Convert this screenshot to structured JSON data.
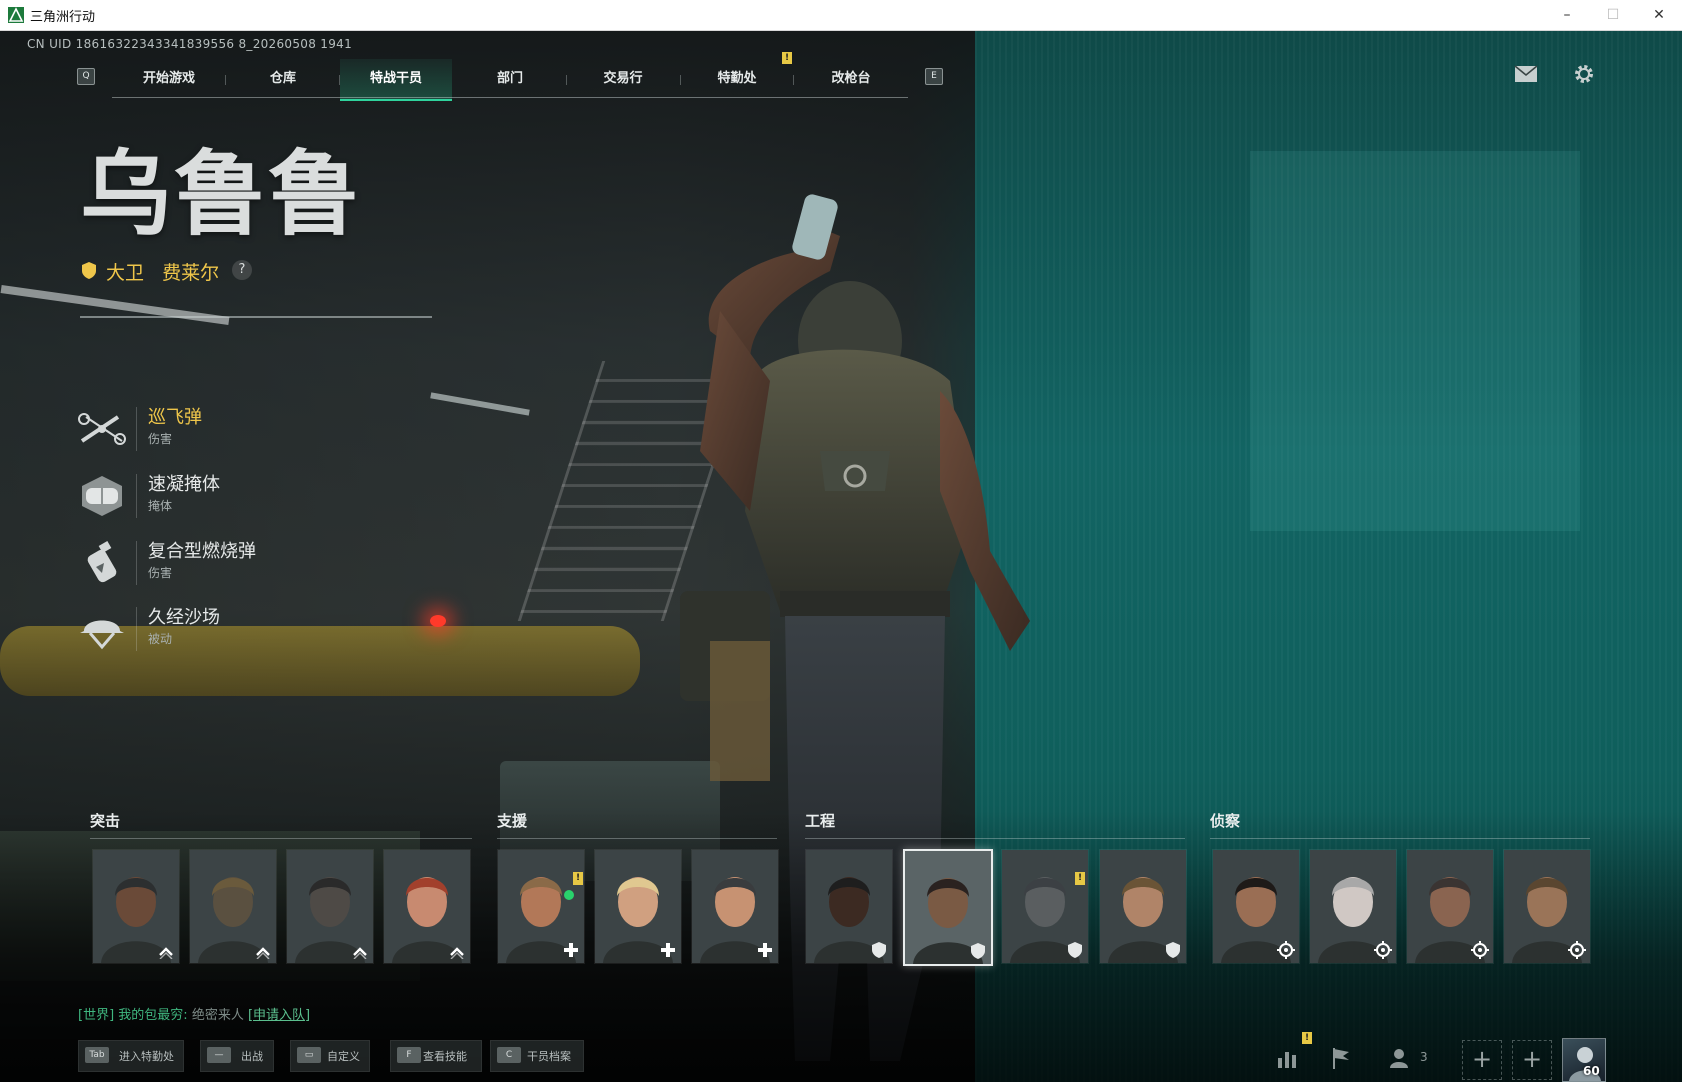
{
  "window": {
    "title": "三角洲行动",
    "controls": {
      "minimize": "–",
      "maximize": "☐",
      "close": "✕"
    }
  },
  "hud": {
    "uid": "CN UID 18616322343341839556 8_20260508 1941",
    "nav_key_left": "Q",
    "nav_key_right": "E",
    "nav_badge": "!",
    "tabs": [
      {
        "label": "开始游戏",
        "active": false
      },
      {
        "label": "仓库",
        "active": false
      },
      {
        "label": "特战干员",
        "active": true
      },
      {
        "label": "部门",
        "active": false
      },
      {
        "label": "交易行",
        "active": false
      },
      {
        "label": "特勤处",
        "active": false
      },
      {
        "label": "改枪台",
        "active": false
      }
    ],
    "mail_icon": "mail-icon",
    "settings_icon": "gear-icon"
  },
  "operator": {
    "codename": "乌鲁鲁",
    "realname": "大卫   费莱尔",
    "help": "?",
    "accent": "#efc64a",
    "skills": [
      {
        "name": "巡飞弹",
        "type": "伤害",
        "icon": "drone-icon",
        "active": true
      },
      {
        "name": "速凝掩体",
        "type": "掩体",
        "icon": "cover-icon",
        "active": false
      },
      {
        "name": "复合型燃烧弹",
        "type": "伤害",
        "icon": "grenade-icon",
        "active": false
      },
      {
        "name": "久经沙场",
        "type": "被动",
        "icon": "helmet-icon",
        "active": false
      }
    ]
  },
  "roster": {
    "categories": [
      {
        "label": "突击",
        "badge_icon": "chevron-up-icon"
      },
      {
        "label": "支援",
        "badge_icon": "plus-icon"
      },
      {
        "label": "工程",
        "badge_icon": "shield-icon"
      },
      {
        "label": "侦察",
        "badge_icon": "target-icon"
      }
    ],
    "warn_badge": "!"
  },
  "chat": {
    "channel": "[世界]",
    "name": "我的包最穷:",
    "message": " 绝密来人 ",
    "link": "[申请入队]"
  },
  "hotkeys": [
    {
      "key": "Tab",
      "label": "进入特勤处"
    },
    {
      "key": "—",
      "label": "出战"
    },
    {
      "key": "▭",
      "label": "自定义"
    },
    {
      "key": "F",
      "label": "查看技能"
    },
    {
      "key": "C",
      "label": "干员档案"
    }
  ],
  "social": {
    "friends_count": "3",
    "stats_badge": "!",
    "avatar_level": "60"
  },
  "colors": {
    "accent_green": "#2fd39d",
    "gold": "#efc64a",
    "teal_wall": "#126463"
  }
}
